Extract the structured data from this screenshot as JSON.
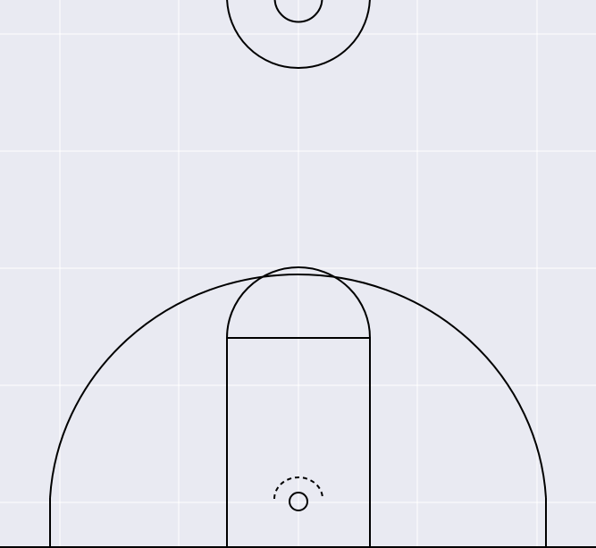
{
  "colors": {
    "background": "#e9eaf2",
    "grid": "#ffffff",
    "lines": "#000000"
  },
  "figure": {
    "type": "basketball-half-court-diagram",
    "grid": true,
    "elements": [
      "center-circle-outer",
      "center-circle-inner",
      "three-point-arc",
      "three-point-corner-left",
      "three-point-corner-right",
      "paint-lane",
      "free-throw-circle-top-half",
      "restricted-area-arc",
      "hoop-rim",
      "baseline"
    ]
  }
}
